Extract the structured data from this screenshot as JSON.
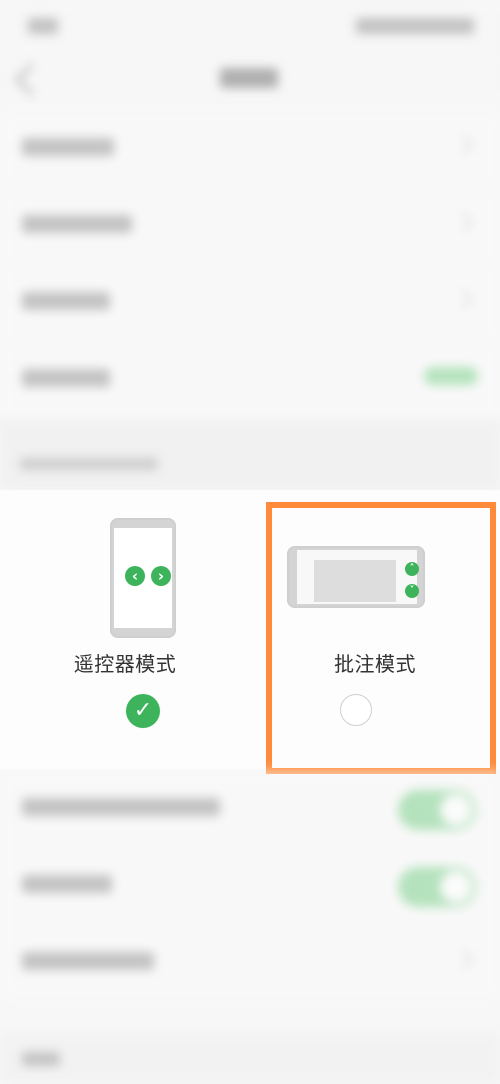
{
  "mode_selector": {
    "remote_mode": {
      "label": "遥控器模式",
      "left_button_icon": "chevron-left-circle-icon",
      "right_button_icon": "chevron-right-circle-icon",
      "selected": true
    },
    "annotation_mode": {
      "label": "批注模式",
      "up_button_icon": "chevron-up-circle-icon",
      "down_button_icon": "chevron-down-circle-icon",
      "selected": false
    }
  },
  "colors": {
    "accent_green": "#3db45b",
    "highlight_orange": "#ff8b3a"
  }
}
